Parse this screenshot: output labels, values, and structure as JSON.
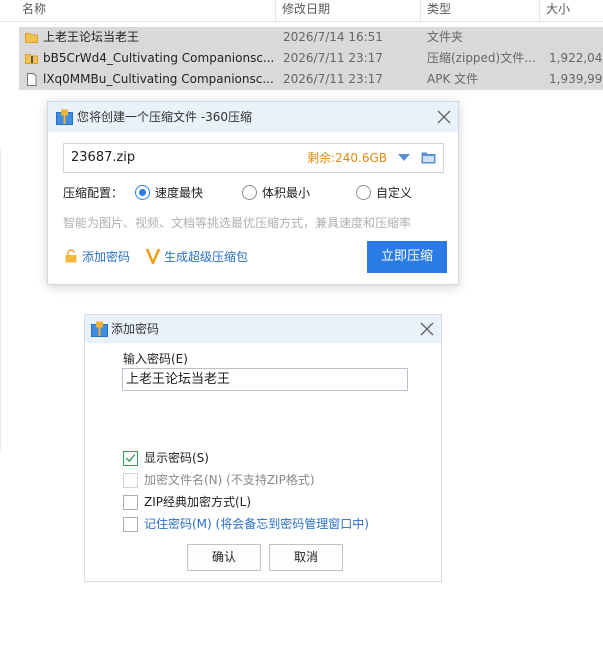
{
  "explorer": {
    "columns": {
      "name": "名称",
      "date": "修改日期",
      "type": "类型",
      "size": "大小"
    },
    "files": [
      {
        "name": "上老王论坛当老王",
        "date": "2026/7/14 16:51",
        "type": "文件夹",
        "size": "",
        "icon": "folder-icon"
      },
      {
        "name": "bB5CrWd4_Cultivating Companionsc...",
        "date": "2026/7/11 23:17",
        "type": "压缩(zipped)文件...",
        "size": "1,922,04",
        "icon": "zip-icon"
      },
      {
        "name": "lXq0MMBu_Cultivating Companionsc...",
        "date": "2026/7/11 23:17",
        "type": "APK 文件",
        "size": "1,939,99",
        "icon": "file-icon"
      }
    ]
  },
  "compress_dialog": {
    "title": "您将创建一个压缩文件 -360压缩",
    "filename": "23687.zip",
    "remaining": "剩余:240.6GB",
    "config_label": "压缩配置：",
    "options": [
      "速度最快",
      "体积最小",
      "自定义"
    ],
    "selected_option": "速度最快",
    "hint": "智能为图片、视频、文档等挑选最优压缩方式，兼具速度和压缩率",
    "add_password": "添加密码",
    "super_compress": "生成超级压缩包",
    "compress_now": "立即压缩"
  },
  "password_dialog": {
    "title": "添加密码",
    "input_label": "输入密码(E)",
    "password_value": "上老王论坛当老王",
    "checkboxes": [
      {
        "label": "显示密码(S)",
        "checked": true,
        "style": "normal"
      },
      {
        "label": "加密文件名(N) (不支持ZIP格式)",
        "checked": false,
        "style": "grey"
      },
      {
        "label": "ZIP经典加密方式(L)",
        "checked": false,
        "style": "normal"
      },
      {
        "label": "记住密码(M) (将会备忘到密码管理窗口中)",
        "checked": false,
        "style": "blue"
      }
    ],
    "ok": "确认",
    "cancel": "取消"
  },
  "colors": {
    "accent": "#2a7be4",
    "remaining": "#e08a14",
    "link": "#2a6fc9",
    "selection": "#d9d9d9"
  }
}
